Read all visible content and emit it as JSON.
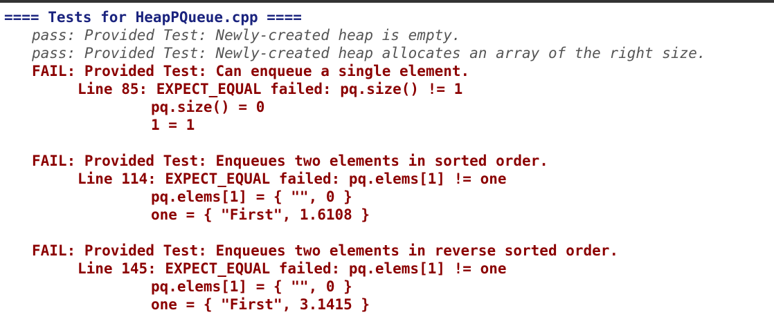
{
  "console": {
    "header": "==== Tests for HeapPQueue.cpp ====",
    "lines": [
      {
        "kind": "pass",
        "text": "pass: Provided Test: Newly-created heap is empty."
      },
      {
        "kind": "pass",
        "text": "pass: Provided Test: Newly-created heap allocates an array of the right size."
      },
      {
        "kind": "fail",
        "text": "FAIL: Provided Test: Can enqueue a single element."
      },
      {
        "kind": "detail",
        "text": "Line 85: EXPECT_EQUAL failed: pq.size() != 1"
      },
      {
        "kind": "value",
        "text": "pq.size() = 0"
      },
      {
        "kind": "value",
        "text": "1 = 1"
      },
      {
        "kind": "fail",
        "text": "FAIL: Provided Test: Enqueues two elements in sorted order."
      },
      {
        "kind": "detail",
        "text": "Line 114: EXPECT_EQUAL failed: pq.elems[1] != one"
      },
      {
        "kind": "value",
        "text": "pq.elems[1] = { \"\", 0 }"
      },
      {
        "kind": "value",
        "text": "one = { \"First\", 1.6108 }"
      },
      {
        "kind": "fail",
        "text": "FAIL: Provided Test: Enqueues two elements in reverse sorted order."
      },
      {
        "kind": "detail",
        "text": "Line 145: EXPECT_EQUAL failed: pq.elems[1] != one"
      },
      {
        "kind": "value",
        "text": "pq.elems[1] = { \"\", 0 }"
      },
      {
        "kind": "value",
        "text": "one = { \"First\", 3.1415 }"
      }
    ]
  },
  "colors": {
    "header": "#1a237e",
    "pass": "#555555",
    "fail": "#8b0000",
    "border": "#333333",
    "background": "#ffffff"
  }
}
